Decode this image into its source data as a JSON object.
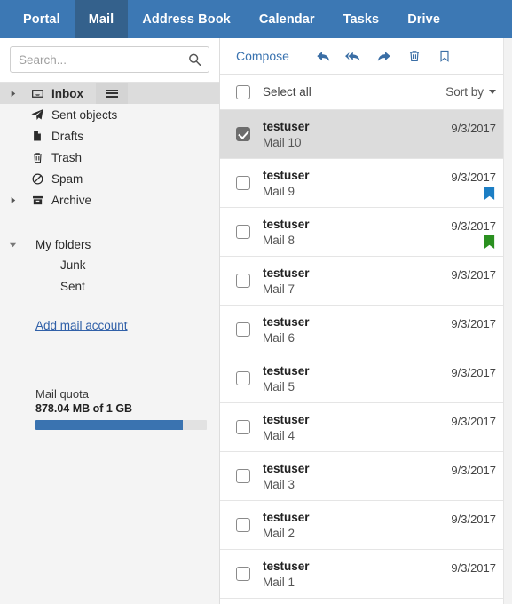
{
  "topnav": {
    "tabs": [
      {
        "label": "Portal",
        "active": false
      },
      {
        "label": "Mail",
        "active": true
      },
      {
        "label": "Address Book",
        "active": false
      },
      {
        "label": "Calendar",
        "active": false
      },
      {
        "label": "Tasks",
        "active": false
      },
      {
        "label": "Drive",
        "active": false
      }
    ]
  },
  "colors": {
    "header_blue": "#3c78b4",
    "active_tab_blue": "#34618c",
    "accent_link": "#3a73b0",
    "quota_fill": "#3a73b0",
    "flag_blue": "#1c7ec4",
    "flag_green": "#2a9020",
    "selected_row": "#dcdcdc"
  },
  "sidebar": {
    "search": {
      "value": "",
      "placeholder": "Search...",
      "icon": "search-icon"
    },
    "folders": [
      {
        "label": "Inbox",
        "icon": "inbox-icon",
        "twisty": "right",
        "selected": true,
        "menu": true
      },
      {
        "label": "Sent objects",
        "icon": "paper-plane-icon",
        "twisty": "none",
        "selected": false,
        "menu": false
      },
      {
        "label": "Drafts",
        "icon": "document-icon",
        "twisty": "none",
        "selected": false,
        "menu": false
      },
      {
        "label": "Trash",
        "icon": "trash-icon",
        "twisty": "none",
        "selected": false,
        "menu": false
      },
      {
        "label": "Spam",
        "icon": "ban-icon",
        "twisty": "none",
        "selected": false,
        "menu": false
      },
      {
        "label": "Archive",
        "icon": "archive-icon",
        "twisty": "right",
        "selected": false,
        "menu": false
      }
    ],
    "my_folders": {
      "label": "My folders",
      "twisty": "down",
      "children": [
        {
          "label": "Junk"
        },
        {
          "label": "Sent"
        }
      ]
    },
    "add_account_label": "Add mail account",
    "quota": {
      "title": "Mail quota",
      "value": "878.04 MB of 1 GB",
      "percent": 86
    }
  },
  "mail": {
    "toolbar": {
      "compose_label": "Compose",
      "icons": [
        {
          "name": "reply-icon"
        },
        {
          "name": "reply-all-icon"
        },
        {
          "name": "forward-icon"
        },
        {
          "name": "trash-icon"
        },
        {
          "name": "bookmark-icon"
        }
      ]
    },
    "list_header": {
      "select_all_label": "Select all",
      "select_all_checked": false,
      "sort_by_label": "Sort by"
    },
    "messages": [
      {
        "sender": "testuser",
        "subject": "Mail 10",
        "date": "9/3/2017",
        "checked": true,
        "selected": true,
        "flag": "none"
      },
      {
        "sender": "testuser",
        "subject": "Mail 9",
        "date": "9/3/2017",
        "checked": false,
        "selected": false,
        "flag": "blue"
      },
      {
        "sender": "testuser",
        "subject": "Mail 8",
        "date": "9/3/2017",
        "checked": false,
        "selected": false,
        "flag": "green"
      },
      {
        "sender": "testuser",
        "subject": "Mail 7",
        "date": "9/3/2017",
        "checked": false,
        "selected": false,
        "flag": "none"
      },
      {
        "sender": "testuser",
        "subject": "Mail 6",
        "date": "9/3/2017",
        "checked": false,
        "selected": false,
        "flag": "none"
      },
      {
        "sender": "testuser",
        "subject": "Mail 5",
        "date": "9/3/2017",
        "checked": false,
        "selected": false,
        "flag": "none"
      },
      {
        "sender": "testuser",
        "subject": "Mail 4",
        "date": "9/3/2017",
        "checked": false,
        "selected": false,
        "flag": "none"
      },
      {
        "sender": "testuser",
        "subject": "Mail 3",
        "date": "9/3/2017",
        "checked": false,
        "selected": false,
        "flag": "none"
      },
      {
        "sender": "testuser",
        "subject": "Mail 2",
        "date": "9/3/2017",
        "checked": false,
        "selected": false,
        "flag": "none"
      },
      {
        "sender": "testuser",
        "subject": "Mail 1",
        "date": "9/3/2017",
        "checked": false,
        "selected": false,
        "flag": "none"
      }
    ]
  }
}
